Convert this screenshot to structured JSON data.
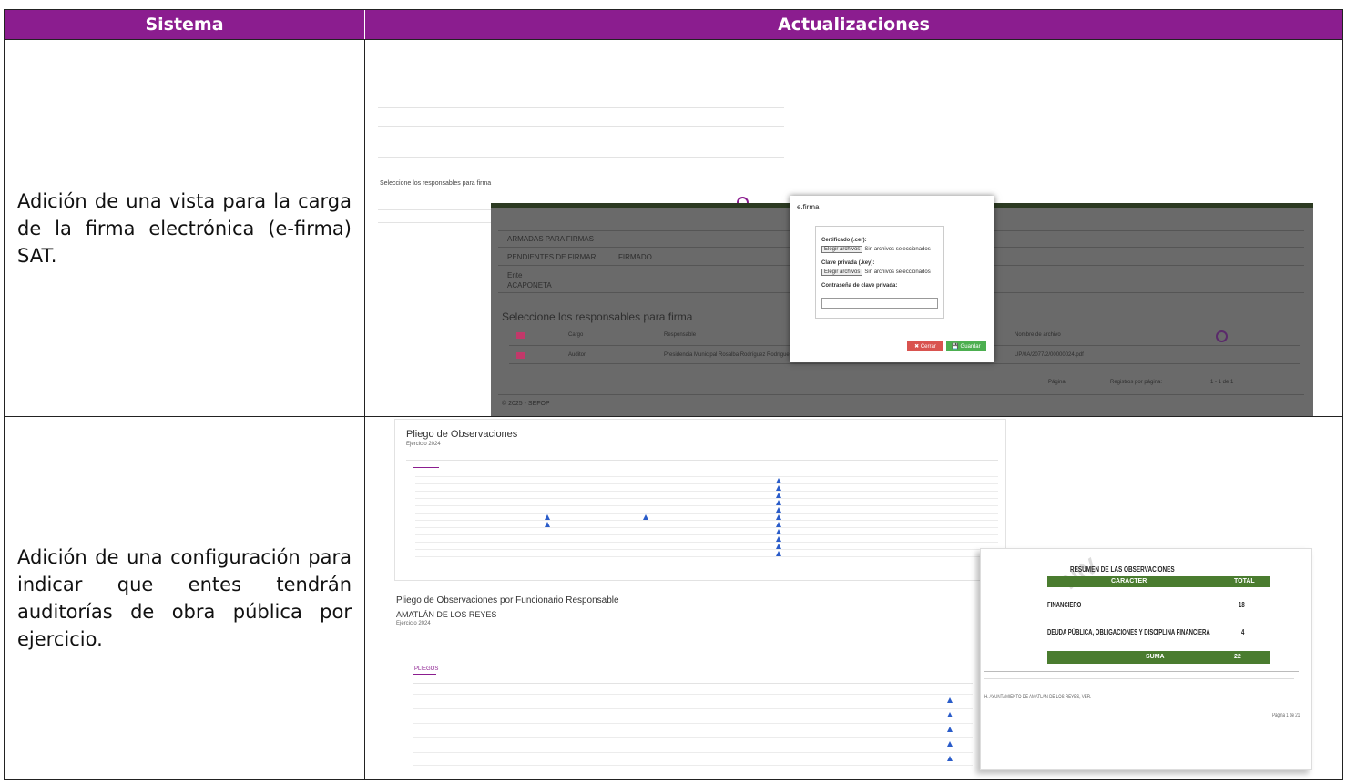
{
  "table": {
    "header": {
      "col1": "Sistema",
      "col2": "Actualizaciones"
    },
    "rows": [
      {
        "description": "Adición de una vista para la carga de la firma electrónica (e-firma) SAT."
      },
      {
        "description": "Adición de una configuración para indicar que entes tendrán auditorías de obra pública por ejercicio."
      }
    ]
  },
  "efirma_screenshot": {
    "section_heading": "Seleccione los responsables para firma",
    "tab_firmadas": "ARMADAS PARA FIRMAS",
    "tab_pendientes": "PENDIENTES DE FIRMAR",
    "tab_firmado": "FIRMADO",
    "ente_label": "Ente",
    "ente_value": "ACAPONETA",
    "col_cargo": "Cargo",
    "col_responsable": "Responsable",
    "col_nombre_archivo": "Nombre de archivo",
    "row_cargo": "Auditor",
    "row_responsable": "Presidencia Municipal Rosalba Rodríguez Rodríguez",
    "row_archivo": "UP/0A/2077/2/00000024.pdf",
    "paginacion": "Página:",
    "registros": "Registros por página:",
    "rango": "1 - 1 de 1",
    "footer": "© 2025 - SEFOP",
    "modal": {
      "title": "e.firma",
      "cert_label": "Certificado (.cer):",
      "key_label": "Clave privada (.key):",
      "pass_label": "Contraseña de clave privada:",
      "file_button": "Elegir archivos",
      "no_file": "Sin archivos seleccionados",
      "cancel": "✖ Cerrar",
      "save": "💾 Guardar"
    }
  },
  "pliego_screenshot": {
    "title_top": "Pliego de Observaciones",
    "subtitle_top": "Ejercicio 2024",
    "title_bottom": "Pliego de Observaciones por Funcionario Responsable",
    "ente": "AMATLÁN DE LOS REYES",
    "ejercicio": "Ejercicio 2024",
    "tab": "PLIEGOS",
    "pdf": {
      "watermark": "NIV",
      "title": "RESUMEN DE LAS OBSERVACIONES",
      "col_caracter": "CARACTER",
      "col_total": "TOTAL",
      "row1_label": "FINANCIERO",
      "row1_value": "18",
      "row2_label": "DEUDA PÚBLICA, OBLIGACIONES Y DISCIPLINA FINANCIERA",
      "row2_value": "4",
      "sum_label": "SUMA",
      "sum_value": "22",
      "footer_text": "H. AYUNTAMIENTO DE AMATLÁN DE LOS REYES, VER.",
      "page": "Página 1 de 21"
    }
  }
}
